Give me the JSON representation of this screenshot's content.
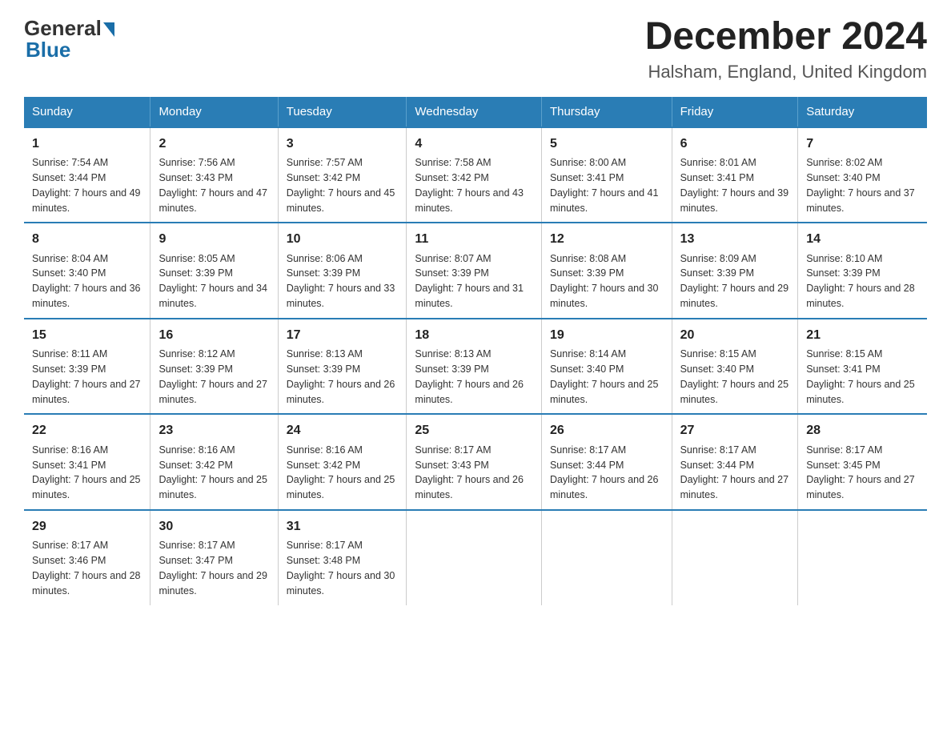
{
  "logo": {
    "general": "General",
    "blue": "Blue"
  },
  "title": "December 2024",
  "subtitle": "Halsham, England, United Kingdom",
  "headers": [
    "Sunday",
    "Monday",
    "Tuesday",
    "Wednesday",
    "Thursday",
    "Friday",
    "Saturday"
  ],
  "weeks": [
    [
      {
        "day": "1",
        "sunrise": "7:54 AM",
        "sunset": "3:44 PM",
        "daylight": "7 hours and 49 minutes."
      },
      {
        "day": "2",
        "sunrise": "7:56 AM",
        "sunset": "3:43 PM",
        "daylight": "7 hours and 47 minutes."
      },
      {
        "day": "3",
        "sunrise": "7:57 AM",
        "sunset": "3:42 PM",
        "daylight": "7 hours and 45 minutes."
      },
      {
        "day": "4",
        "sunrise": "7:58 AM",
        "sunset": "3:42 PM",
        "daylight": "7 hours and 43 minutes."
      },
      {
        "day": "5",
        "sunrise": "8:00 AM",
        "sunset": "3:41 PM",
        "daylight": "7 hours and 41 minutes."
      },
      {
        "day": "6",
        "sunrise": "8:01 AM",
        "sunset": "3:41 PM",
        "daylight": "7 hours and 39 minutes."
      },
      {
        "day": "7",
        "sunrise": "8:02 AM",
        "sunset": "3:40 PM",
        "daylight": "7 hours and 37 minutes."
      }
    ],
    [
      {
        "day": "8",
        "sunrise": "8:04 AM",
        "sunset": "3:40 PM",
        "daylight": "7 hours and 36 minutes."
      },
      {
        "day": "9",
        "sunrise": "8:05 AM",
        "sunset": "3:39 PM",
        "daylight": "7 hours and 34 minutes."
      },
      {
        "day": "10",
        "sunrise": "8:06 AM",
        "sunset": "3:39 PM",
        "daylight": "7 hours and 33 minutes."
      },
      {
        "day": "11",
        "sunrise": "8:07 AM",
        "sunset": "3:39 PM",
        "daylight": "7 hours and 31 minutes."
      },
      {
        "day": "12",
        "sunrise": "8:08 AM",
        "sunset": "3:39 PM",
        "daylight": "7 hours and 30 minutes."
      },
      {
        "day": "13",
        "sunrise": "8:09 AM",
        "sunset": "3:39 PM",
        "daylight": "7 hours and 29 minutes."
      },
      {
        "day": "14",
        "sunrise": "8:10 AM",
        "sunset": "3:39 PM",
        "daylight": "7 hours and 28 minutes."
      }
    ],
    [
      {
        "day": "15",
        "sunrise": "8:11 AM",
        "sunset": "3:39 PM",
        "daylight": "7 hours and 27 minutes."
      },
      {
        "day": "16",
        "sunrise": "8:12 AM",
        "sunset": "3:39 PM",
        "daylight": "7 hours and 27 minutes."
      },
      {
        "day": "17",
        "sunrise": "8:13 AM",
        "sunset": "3:39 PM",
        "daylight": "7 hours and 26 minutes."
      },
      {
        "day": "18",
        "sunrise": "8:13 AM",
        "sunset": "3:39 PM",
        "daylight": "7 hours and 26 minutes."
      },
      {
        "day": "19",
        "sunrise": "8:14 AM",
        "sunset": "3:40 PM",
        "daylight": "7 hours and 25 minutes."
      },
      {
        "day": "20",
        "sunrise": "8:15 AM",
        "sunset": "3:40 PM",
        "daylight": "7 hours and 25 minutes."
      },
      {
        "day": "21",
        "sunrise": "8:15 AM",
        "sunset": "3:41 PM",
        "daylight": "7 hours and 25 minutes."
      }
    ],
    [
      {
        "day": "22",
        "sunrise": "8:16 AM",
        "sunset": "3:41 PM",
        "daylight": "7 hours and 25 minutes."
      },
      {
        "day": "23",
        "sunrise": "8:16 AM",
        "sunset": "3:42 PM",
        "daylight": "7 hours and 25 minutes."
      },
      {
        "day": "24",
        "sunrise": "8:16 AM",
        "sunset": "3:42 PM",
        "daylight": "7 hours and 25 minutes."
      },
      {
        "day": "25",
        "sunrise": "8:17 AM",
        "sunset": "3:43 PM",
        "daylight": "7 hours and 26 minutes."
      },
      {
        "day": "26",
        "sunrise": "8:17 AM",
        "sunset": "3:44 PM",
        "daylight": "7 hours and 26 minutes."
      },
      {
        "day": "27",
        "sunrise": "8:17 AM",
        "sunset": "3:44 PM",
        "daylight": "7 hours and 27 minutes."
      },
      {
        "day": "28",
        "sunrise": "8:17 AM",
        "sunset": "3:45 PM",
        "daylight": "7 hours and 27 minutes."
      }
    ],
    [
      {
        "day": "29",
        "sunrise": "8:17 AM",
        "sunset": "3:46 PM",
        "daylight": "7 hours and 28 minutes."
      },
      {
        "day": "30",
        "sunrise": "8:17 AM",
        "sunset": "3:47 PM",
        "daylight": "7 hours and 29 minutes."
      },
      {
        "day": "31",
        "sunrise": "8:17 AM",
        "sunset": "3:48 PM",
        "daylight": "7 hours and 30 minutes."
      },
      null,
      null,
      null,
      null
    ]
  ]
}
